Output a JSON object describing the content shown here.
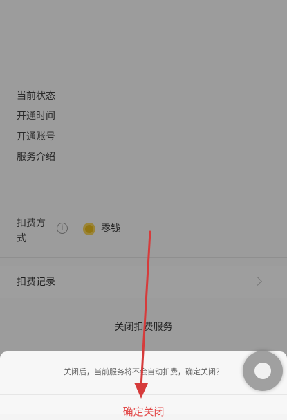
{
  "page": {
    "service_name": "",
    "service_subtitle": "",
    "fields": {
      "status_label": "当前状态",
      "open_time_label": "开通时间",
      "account_label": "开通账号",
      "intro_label": "服务介绍"
    },
    "deduction": {
      "label": "扣费方式",
      "method": "零钱"
    },
    "records_label": "扣费记录",
    "close_service_label": "关闭扣费服务"
  },
  "dialog": {
    "message": "关闭后，当前服务将不会自动扣费，确定关闭？",
    "confirm_label": "确定关闭"
  },
  "colors": {
    "confirm": "#e24848",
    "annotation_arrow": "#d63b3b",
    "coin": "#e8b91c"
  }
}
